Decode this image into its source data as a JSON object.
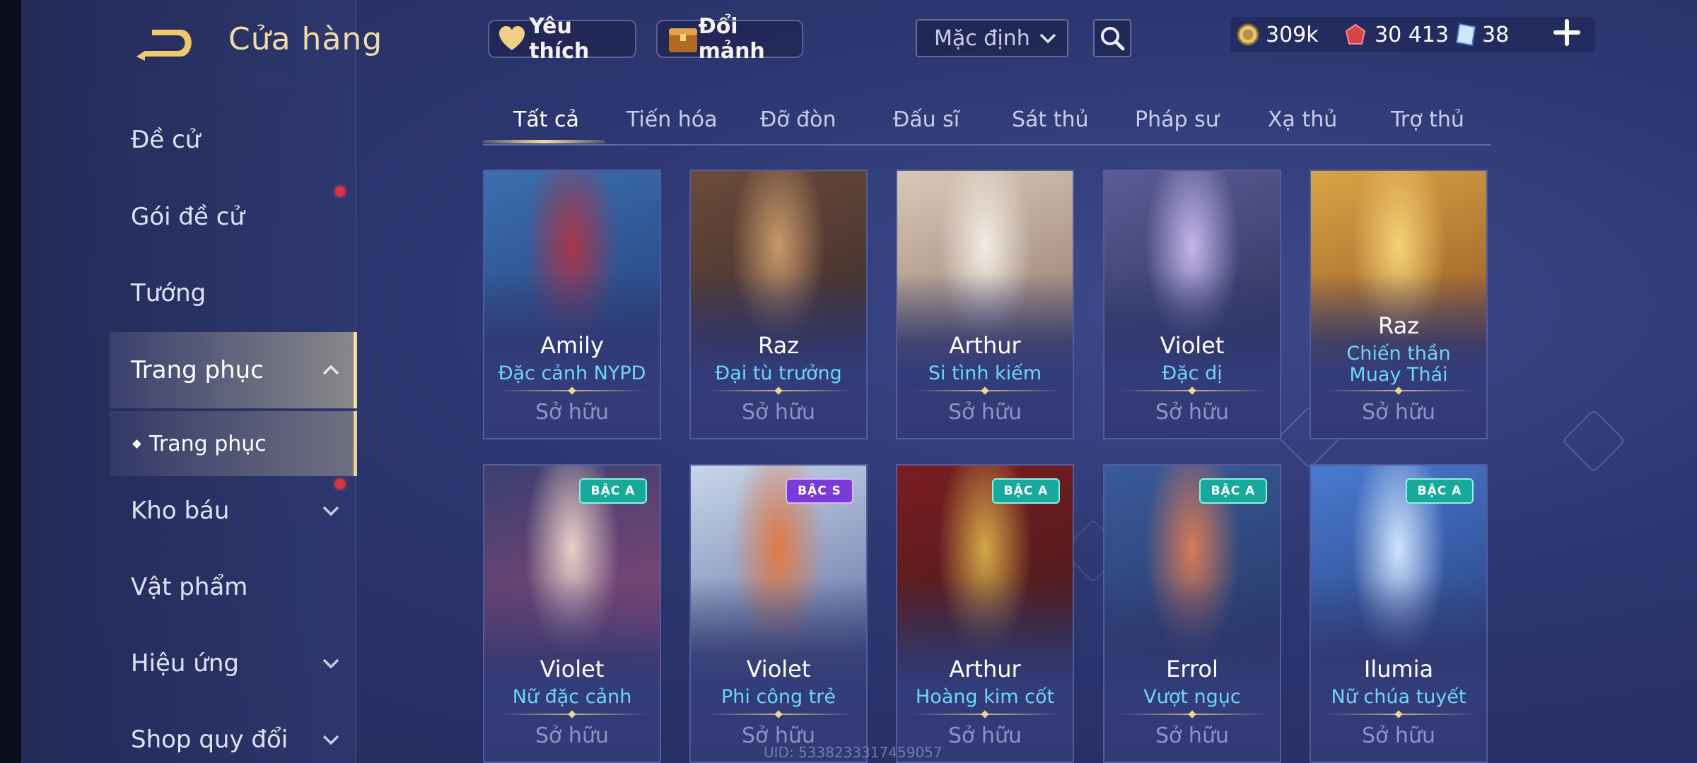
{
  "header": {
    "title": "Cửa hàng",
    "favorite_label": "Yêu thích",
    "exchange_label": "Đổi mảnh",
    "sort_value": "Mặc định"
  },
  "currency": {
    "gold": "309k",
    "ruby": "30 413",
    "voucher": "38"
  },
  "sidebar": {
    "items": [
      {
        "label": "Đề cử"
      },
      {
        "label": "Gói đề cử",
        "dot": true
      },
      {
        "label": "Tướng"
      },
      {
        "label": "Trang phục",
        "active": true
      },
      {
        "label": "Trang phục",
        "sub": true
      },
      {
        "label": "Kho báu",
        "dot": true
      },
      {
        "label": "Vật phẩm"
      },
      {
        "label": "Hiệu ứng"
      },
      {
        "label": "Shop quy đổi"
      }
    ]
  },
  "tabs": [
    {
      "label": "Tất cả",
      "active": true
    },
    {
      "label": "Tiến hóa"
    },
    {
      "label": "Đỡ đòn"
    },
    {
      "label": "Đấu sĩ"
    },
    {
      "label": "Sát thủ"
    },
    {
      "label": "Pháp sư"
    },
    {
      "label": "Xạ thủ"
    },
    {
      "label": "Trợ thủ"
    }
  ],
  "cards": [
    {
      "hero": "Amily",
      "skin": "Đặc cảnh NYPD",
      "status": "Sở hữu",
      "art": [
        "#3b6fb0",
        "#1f2f6a",
        "#a7354a"
      ]
    },
    {
      "hero": "Raz",
      "skin": "Đại tù trưởng",
      "status": "Sở hữu",
      "art": [
        "#6b4a3a",
        "#2b2128",
        "#c99a6a"
      ]
    },
    {
      "hero": "Arthur",
      "skin": "Si tình kiếm",
      "status": "Sở hữu",
      "art": [
        "#d9c8b8",
        "#7a5d52",
        "#f3ece4"
      ]
    },
    {
      "hero": "Violet",
      "skin": "Đặc dị",
      "status": "Sở hữu",
      "art": [
        "#5a5c96",
        "#1e2448",
        "#c6b6ec"
      ]
    },
    {
      "hero": "Raz",
      "skin": "Chiến thần Muay Thái",
      "status": "Sở hữu",
      "art": [
        "#d9a445",
        "#7e3a1a",
        "#f6d276"
      ]
    },
    {
      "hero": "Violet",
      "skin": "Nữ đặc cảnh",
      "status": "Sở hữu",
      "badge": "BẬC A",
      "tier": "A",
      "art": [
        "#3a3f70",
        "#b64a78",
        "#e8d0c8"
      ]
    },
    {
      "hero": "Violet",
      "skin": "Phi công trẻ",
      "status": "Sở hữu",
      "badge": "BẬC S",
      "tier": "S",
      "art": [
        "#c8d6ea",
        "#3a4c86",
        "#e07a48"
      ]
    },
    {
      "hero": "Arthur",
      "skin": "Hoàng kim cốt",
      "status": "Sở hữu",
      "badge": "BẬC A",
      "tier": "A",
      "art": [
        "#7a1c22",
        "#2a1c18",
        "#d4a848"
      ]
    },
    {
      "hero": "Errol",
      "skin": "Vượt ngục",
      "status": "Sở hữu",
      "badge": "BẬC A",
      "tier": "A",
      "art": [
        "#3a5a9a",
        "#1e2a50",
        "#d87a58"
      ]
    },
    {
      "hero": "Ilumia",
      "skin": "Nữ chúa tuyết",
      "status": "Sở hữu",
      "badge": "BẬC A",
      "tier": "A",
      "art": [
        "#4a7ad0",
        "#1c2a62",
        "#cfe4ff"
      ]
    }
  ],
  "uid_text": "UID: 5338233317459057",
  "icons": {
    "back": "back-arrow-icon",
    "heart": "heart-icon",
    "chest": "treasure-chest-icon",
    "search": "search-icon",
    "gold": "gold-coin-icon",
    "ruby": "ruby-gem-icon",
    "voucher": "voucher-icon",
    "add": "plus-icon"
  },
  "colors": {
    "accent_gold": "#f2df9a",
    "skin_name": "#6fd6f4",
    "badge_a": "#18a99a",
    "badge_s": "#7a3bd6",
    "notification": "#e23040"
  }
}
